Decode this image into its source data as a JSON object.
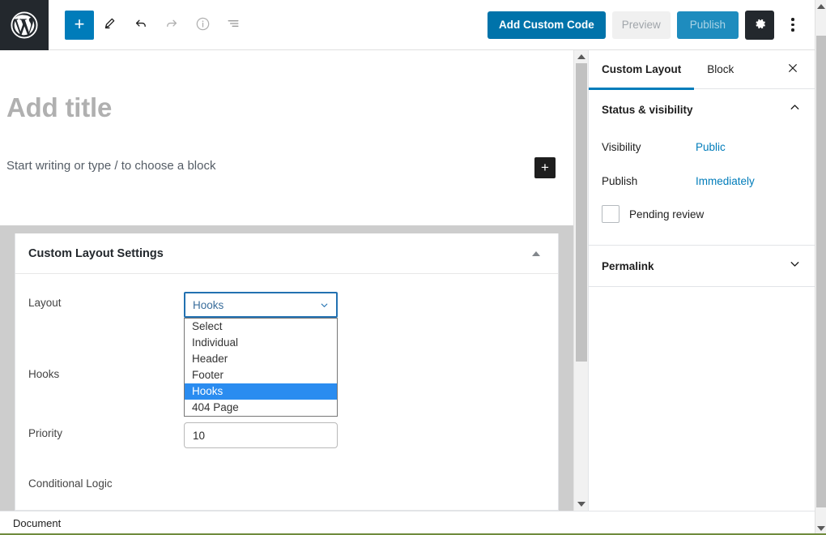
{
  "toolbar": {
    "logo_icon": "wordpress-logo-icon",
    "left_tools": [
      {
        "name": "add-block-button",
        "icon": "plus-icon",
        "label": "+",
        "state": "accent"
      },
      {
        "name": "tools-button",
        "icon": "pencil-icon",
        "label": "",
        "state": "normal"
      },
      {
        "name": "undo-button",
        "icon": "undo-icon",
        "label": "",
        "state": "normal"
      },
      {
        "name": "redo-button",
        "icon": "redo-icon",
        "label": "",
        "state": "disabled"
      },
      {
        "name": "details-button",
        "icon": "info-icon",
        "label": "",
        "state": "disabled"
      },
      {
        "name": "list-view-button",
        "icon": "list-view-icon",
        "label": "",
        "state": "normal"
      }
    ],
    "add_custom_code_label": "Add Custom Code",
    "preview_label": "Preview",
    "publish_label": "Publish",
    "settings_icon": "gear-icon",
    "more_icon": "kebab-menu-icon",
    "accent_color": "#0073aa",
    "publish_color": "#1e8cbe"
  },
  "editor": {
    "title_placeholder": "Add title",
    "paragraph_placeholder": "Start writing or type / to choose a block",
    "block_appender_label": "+"
  },
  "metabox": {
    "title": "Custom Layout Settings",
    "toggle_icon": "triangle-up-icon",
    "fields": {
      "layout_label": "Layout",
      "hooks_label": "Hooks",
      "priority_label": "Priority",
      "conditional_logic_label": "Conditional Logic"
    },
    "layout_select": {
      "value": "Hooks",
      "chevron_icon": "chevron-down-icon",
      "open": true,
      "options": [
        "Select",
        "Individual",
        "Header",
        "Footer",
        "Hooks",
        "404 Page"
      ],
      "selected_index": 4,
      "highlight_color": "#2a8cf0",
      "focus_border_color": "#2271b1"
    },
    "priority_value": "10"
  },
  "sidebar": {
    "tabs": [
      {
        "label": "Custom Layout",
        "active": true
      },
      {
        "label": "Block",
        "active": false
      }
    ],
    "close_icon": "close-icon",
    "active_underline_color": "#007cba",
    "panels": [
      {
        "title": "Status & visibility",
        "expanded": true,
        "chevron_icon": "chevron-up-icon",
        "rows": [
          {
            "label": "Visibility",
            "value": "Public"
          },
          {
            "label": "Publish",
            "value": "Immediately"
          }
        ],
        "checkbox": {
          "label": "Pending review",
          "checked": false
        }
      },
      {
        "title": "Permalink",
        "expanded": false,
        "chevron_icon": "chevron-down-icon",
        "rows": [],
        "checkbox": null
      }
    ]
  },
  "footer": {
    "breadcrumb": "Document"
  },
  "scrollbars": {
    "inner": {
      "up_icon": "triangle-up-icon",
      "down_icon": "triangle-down-icon"
    },
    "outer": {
      "up_icon": "triangle-up-icon",
      "down_icon": "triangle-down-icon"
    }
  }
}
